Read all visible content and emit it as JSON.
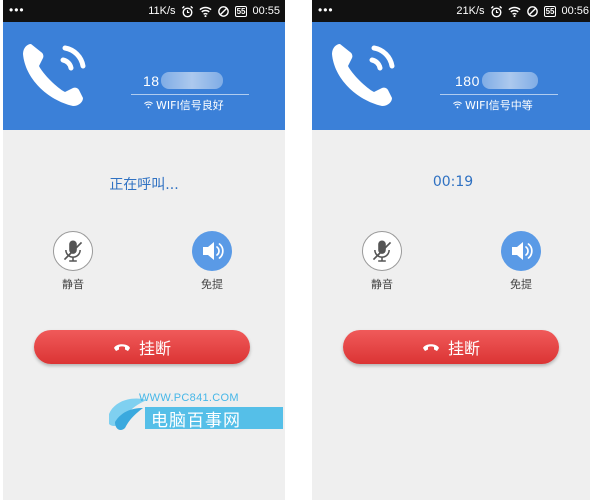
{
  "phones": [
    {
      "statusbar": {
        "menu": "•••",
        "speed": "11K/s",
        "battery": "55",
        "time": "00:55"
      },
      "caller": {
        "number_visible": "18",
        "signal": "WIFI信号良好"
      },
      "call_status": "正在呼叫...",
      "controls": {
        "mute_label": "静音",
        "speaker_label": "免提"
      },
      "hangup_label": "挂断"
    },
    {
      "statusbar": {
        "menu": "•••",
        "speed": "21K/s",
        "battery": "55",
        "time": "00:56"
      },
      "caller": {
        "number_visible": "180",
        "signal": "WIFI信号中等"
      },
      "call_status": "00:19",
      "controls": {
        "mute_label": "静音",
        "speaker_label": "免提"
      },
      "hangup_label": "挂断"
    }
  ],
  "watermark": {
    "url": "WWW.PC841.COM",
    "name": "电脑百事网"
  },
  "colors": {
    "header": "#3b80d8",
    "hangup": "#e44444",
    "status_text": "#2f71c2",
    "speaker": "#5a9ae6"
  },
  "icons": [
    "phone-call-icon",
    "wifi-icon",
    "alarm-icon",
    "mute-microphone-icon",
    "speaker-icon",
    "hangup-handset-icon"
  ]
}
